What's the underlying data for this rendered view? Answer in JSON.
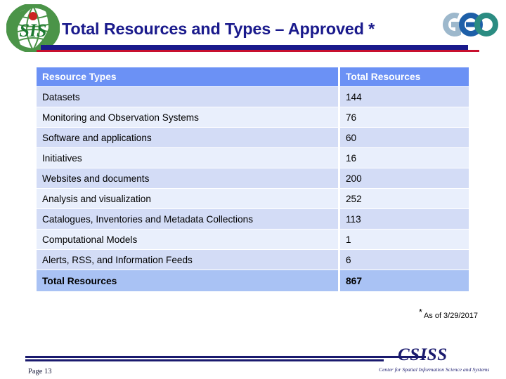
{
  "slide": {
    "title": "Total Resources and Types – Approved *",
    "footnote_marker": "*",
    "footnote_text": "As of 3/29/2017",
    "page_label": "Page  13"
  },
  "brand": {
    "csiss_logo_alt": "csiss-globe-logo",
    "csiss_logo_text": "SIS",
    "geo_logo_alt": "geo-logo",
    "geo_letters": [
      "G",
      "E",
      "O"
    ],
    "wordmark": "CSISS",
    "tagline": "Center for Spatial Information Science and Systems"
  },
  "colors": {
    "title_navy": "#1a1a8c",
    "rule_red": "#c8102e",
    "header_blue": "#6b91f5",
    "row_odd": "#d3dcf6",
    "row_even": "#e9effc",
    "total_row": "#a9c2f4",
    "geo_g": "#9db8cc",
    "geo_e": "#1d5fa8",
    "geo_o": "#2b8c82",
    "logo_green": "#4b9448",
    "logo_red": "#cc2222"
  },
  "table": {
    "columns": [
      "Resource Types",
      "Total Resources"
    ],
    "rows": [
      {
        "type": "Datasets",
        "total": "144"
      },
      {
        "type": "Monitoring and Observation Systems",
        "total": "76"
      },
      {
        "type": "Software and applications",
        "total": "60"
      },
      {
        "type": "Initiatives",
        "total": "16"
      },
      {
        "type": "Websites and documents",
        "total": "200"
      },
      {
        "type": "Analysis and visualization",
        "total": "252"
      },
      {
        "type": "Catalogues, Inventories and Metadata Collections",
        "total": "113"
      },
      {
        "type": "Computational Models",
        "total": "1"
      },
      {
        "type": "Alerts, RSS, and Information Feeds",
        "total": "6"
      }
    ],
    "total_row": {
      "type": "Total Resources",
      "total": "867"
    }
  }
}
